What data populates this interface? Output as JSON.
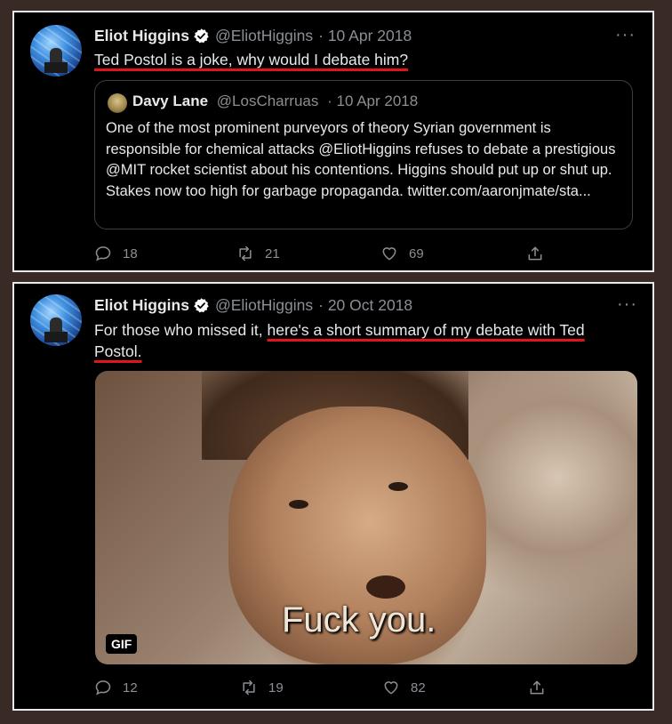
{
  "tweets": [
    {
      "author": "Eliot Higgins",
      "handle": "@EliotHiggins",
      "date": "· 10 Apr 2018",
      "text_plain": "",
      "text_underlined": "Ted Postol is a joke, why would I debate him?",
      "more": "···",
      "quote": {
        "author": "Davy Lane",
        "handle": "@LosCharruas",
        "date": "· 10 Apr 2018",
        "text": "One of the most prominent purveyors of theory Syrian government is responsible for chemical attacks  @EliotHiggins refuses to debate a prestigious @MIT rocket scientist about his contentions. Higgins should put up or shut up. Stakes now too high for garbage propaganda. twitter.com/aaronjmate/sta..."
      },
      "replies": "18",
      "retweets": "21",
      "likes": "69"
    },
    {
      "author": "Eliot Higgins",
      "handle": "@EliotHiggins",
      "date": "· 20 Oct 2018",
      "text_plain": "For those who missed it, ",
      "text_underlined": "here's a short summary of my debate with Ted Postol.",
      "more": "···",
      "media": {
        "caption": "Fuck you.",
        "badge": "GIF"
      },
      "replies": "12",
      "retweets": "19",
      "likes": "82"
    }
  ],
  "colors": {
    "underline": "#e0141a",
    "verified": "#ffffff",
    "background": "#000000"
  },
  "icons": [
    "verified-icon",
    "reply-icon",
    "retweet-icon",
    "like-icon",
    "share-icon",
    "more-icon"
  ]
}
